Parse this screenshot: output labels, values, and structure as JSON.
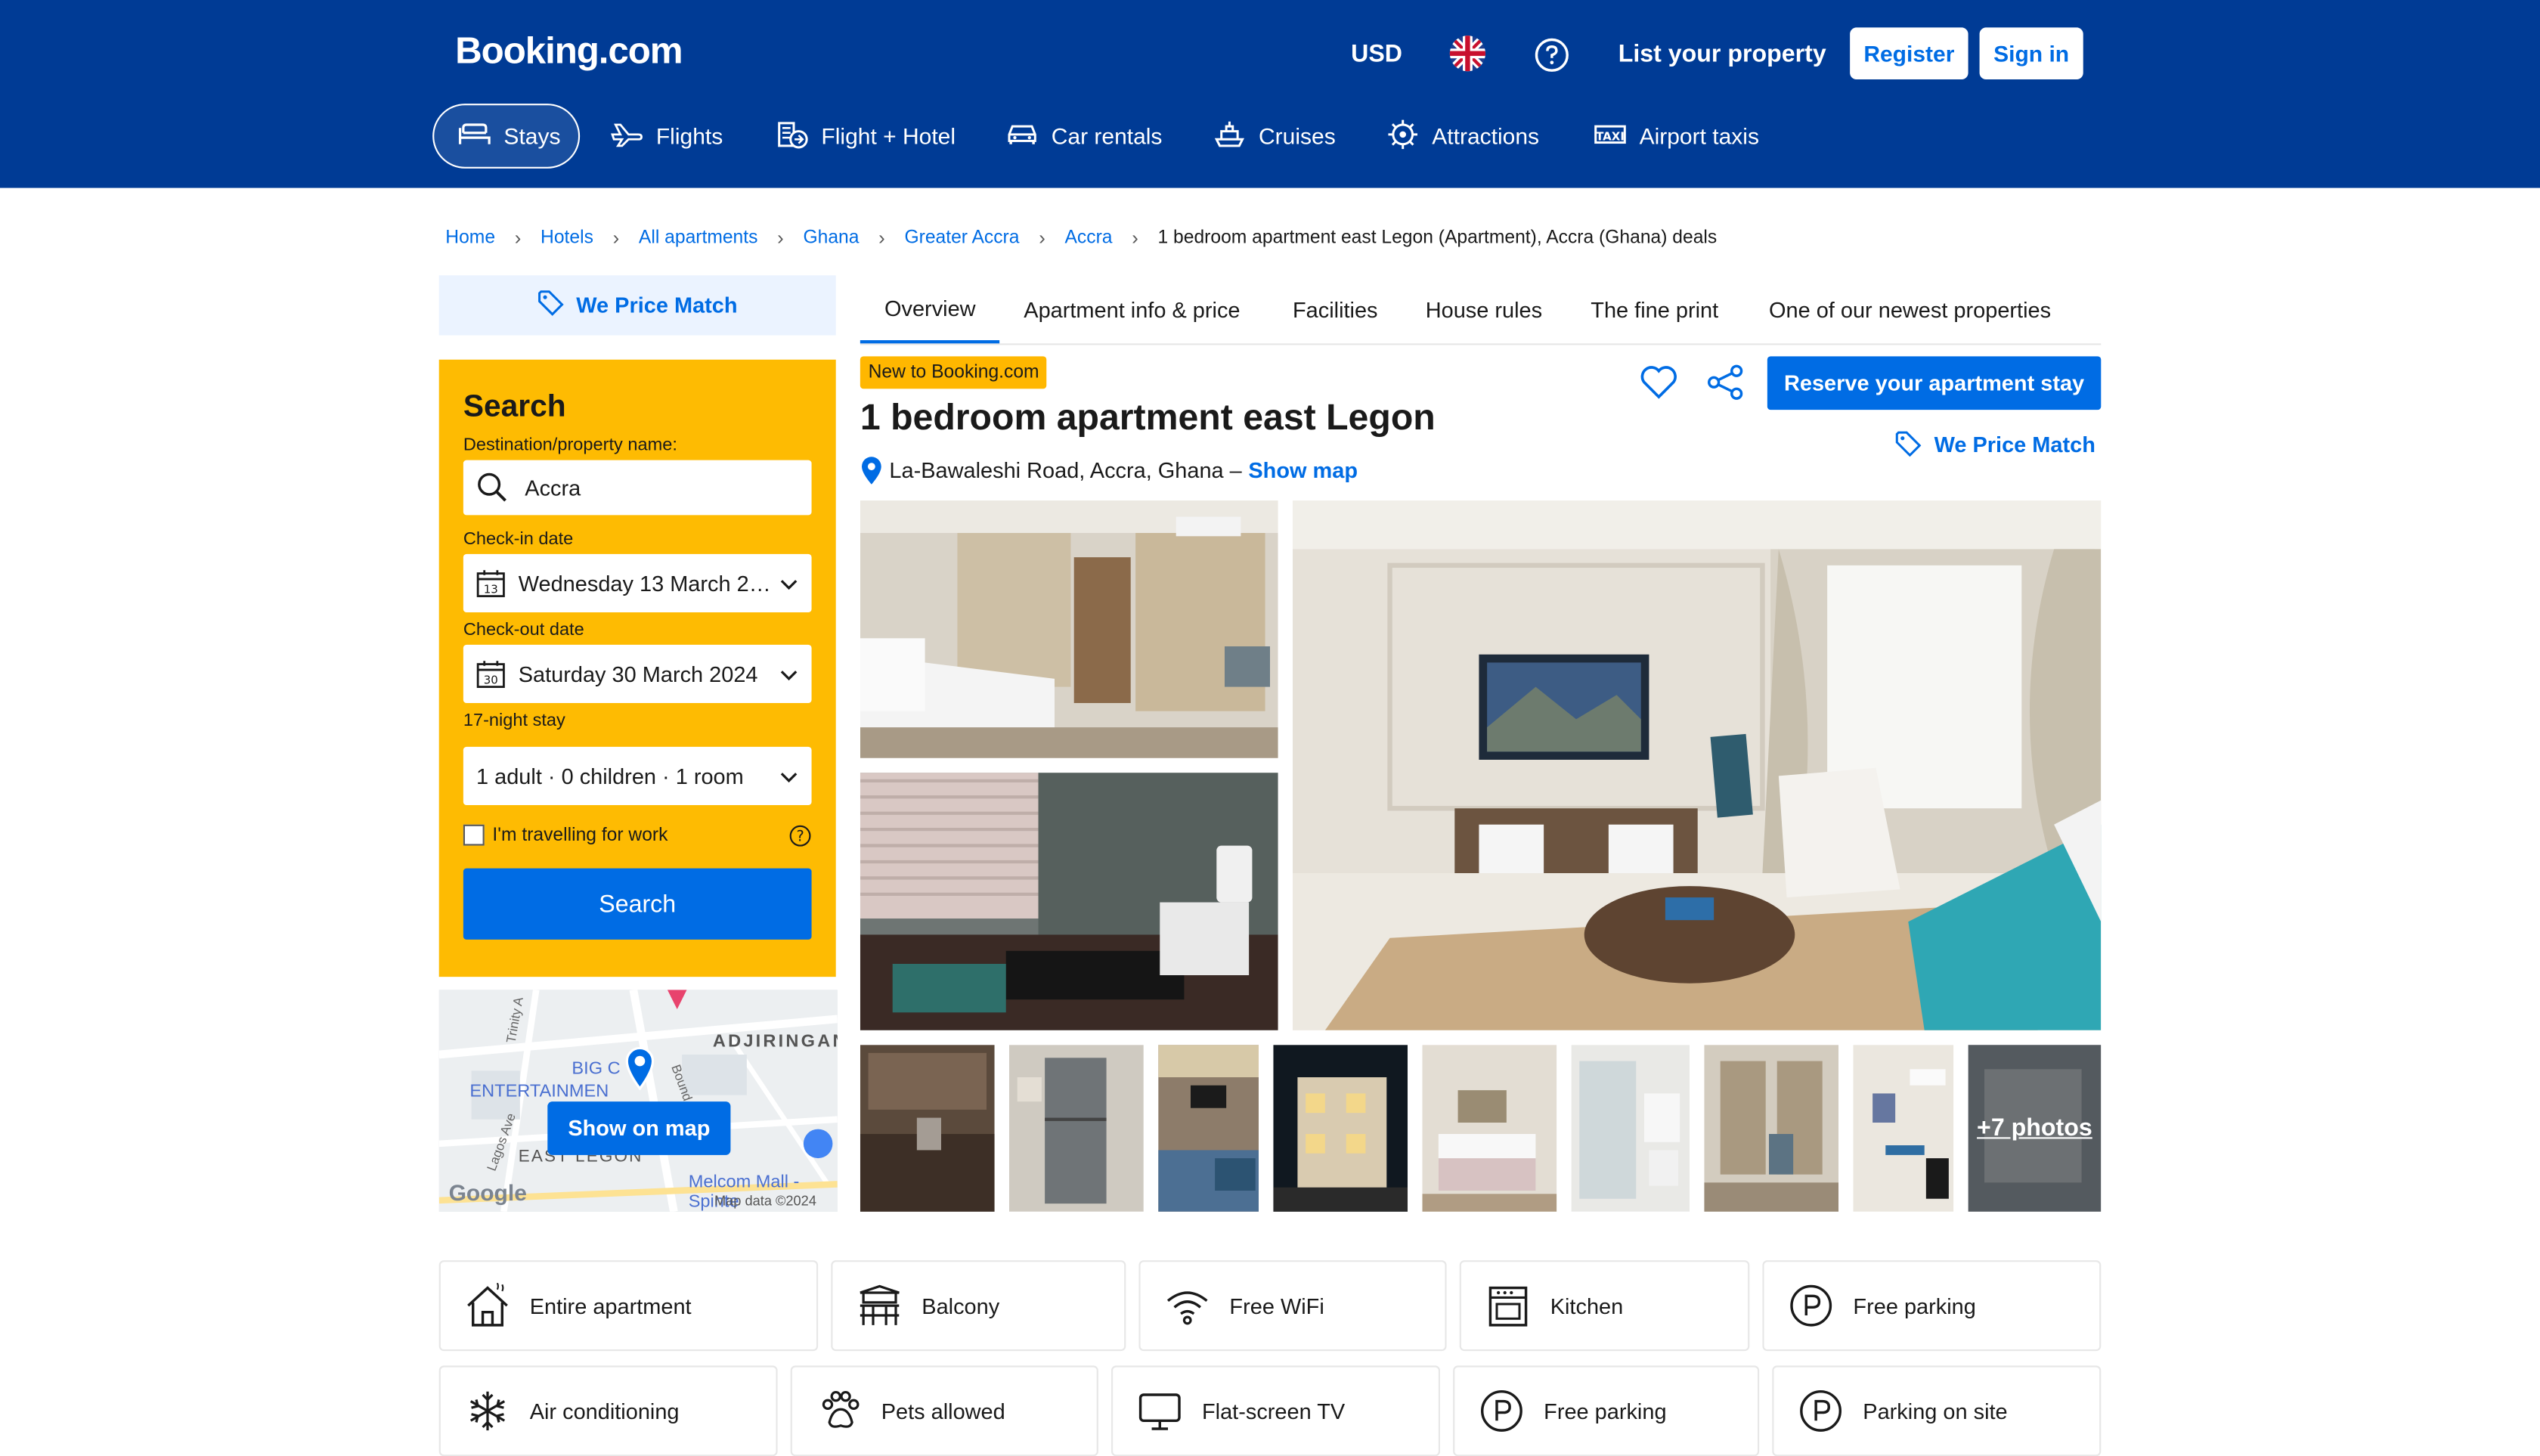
{
  "header": {
    "logo": "Booking.com",
    "currency": "USD",
    "list_property": "List your property",
    "register": "Register",
    "sign_in": "Sign in"
  },
  "nav": [
    {
      "label": "Stays",
      "icon": "bed-icon"
    },
    {
      "label": "Flights",
      "icon": "plane-icon"
    },
    {
      "label": "Flight + Hotel",
      "icon": "flight-hotel-icon"
    },
    {
      "label": "Car rentals",
      "icon": "car-icon"
    },
    {
      "label": "Cruises",
      "icon": "ship-icon"
    },
    {
      "label": "Attractions",
      "icon": "attractions-icon"
    },
    {
      "label": "Airport taxis",
      "icon": "taxi-icon"
    }
  ],
  "breadcrumb": [
    "Home",
    "Hotels",
    "All apartments",
    "Ghana",
    "Greater Accra",
    "Accra",
    "1 bedroom apartment east Legon (Apartment), Accra (Ghana) deals"
  ],
  "price_match": "We Price Match",
  "search": {
    "title": "Search",
    "destination_label": "Destination/property name:",
    "destination_value": "Accra",
    "checkin_label": "Check-in date",
    "checkin_value": "Wednesday 13 March 2…",
    "checkin_day": "13",
    "checkout_label": "Check-out date",
    "checkout_value": "Saturday 30 March 2024",
    "checkout_day": "30",
    "stay_length": "17-night stay",
    "guests": "1 adult · 0 children · 1 room",
    "work_travel": "I'm travelling for work",
    "button": "Search"
  },
  "map": {
    "show_on_map": "Show on map",
    "labels": [
      "ADJIRINGAN",
      "BIG C",
      "ENTERTAINMEN",
      "EAST LEGON",
      "Trinity A",
      "Lagos Ave",
      "Bound",
      "Melcom Mall - Spinte"
    ],
    "google": "Google",
    "attribution": "Map data ©2024"
  },
  "tabs": [
    "Overview",
    "Apartment info & price",
    "Facilities",
    "House rules",
    "The fine print",
    "One of our newest properties"
  ],
  "property": {
    "badge": "New to Booking.com",
    "title": "1 bedroom apartment east Legon",
    "address": "La-Bawaleshi Road, Accra, Ghana –",
    "show_map": "Show map",
    "reserve": "Reserve your apartment stay",
    "more_photos": "+7 photos"
  },
  "facilities": [
    {
      "label": "Entire apartment",
      "icon": "house-icon"
    },
    {
      "label": "Balcony",
      "icon": "balcony-icon"
    },
    {
      "label": "Free WiFi",
      "icon": "wifi-icon"
    },
    {
      "label": "Kitchen",
      "icon": "kitchen-icon"
    },
    {
      "label": "Free parking",
      "icon": "parking-icon"
    },
    {
      "label": "Air conditioning",
      "icon": "snowflake-icon"
    },
    {
      "label": "Pets allowed",
      "icon": "paw-icon"
    },
    {
      "label": "Flat-screen TV",
      "icon": "tv-icon"
    },
    {
      "label": "Free parking",
      "icon": "parking-icon"
    },
    {
      "label": "Parking on site",
      "icon": "parking-icon"
    }
  ],
  "colors": {
    "brand": "#003b95",
    "accent": "#006ce4",
    "search_bg": "#febb02",
    "badge": "#ffb700"
  }
}
